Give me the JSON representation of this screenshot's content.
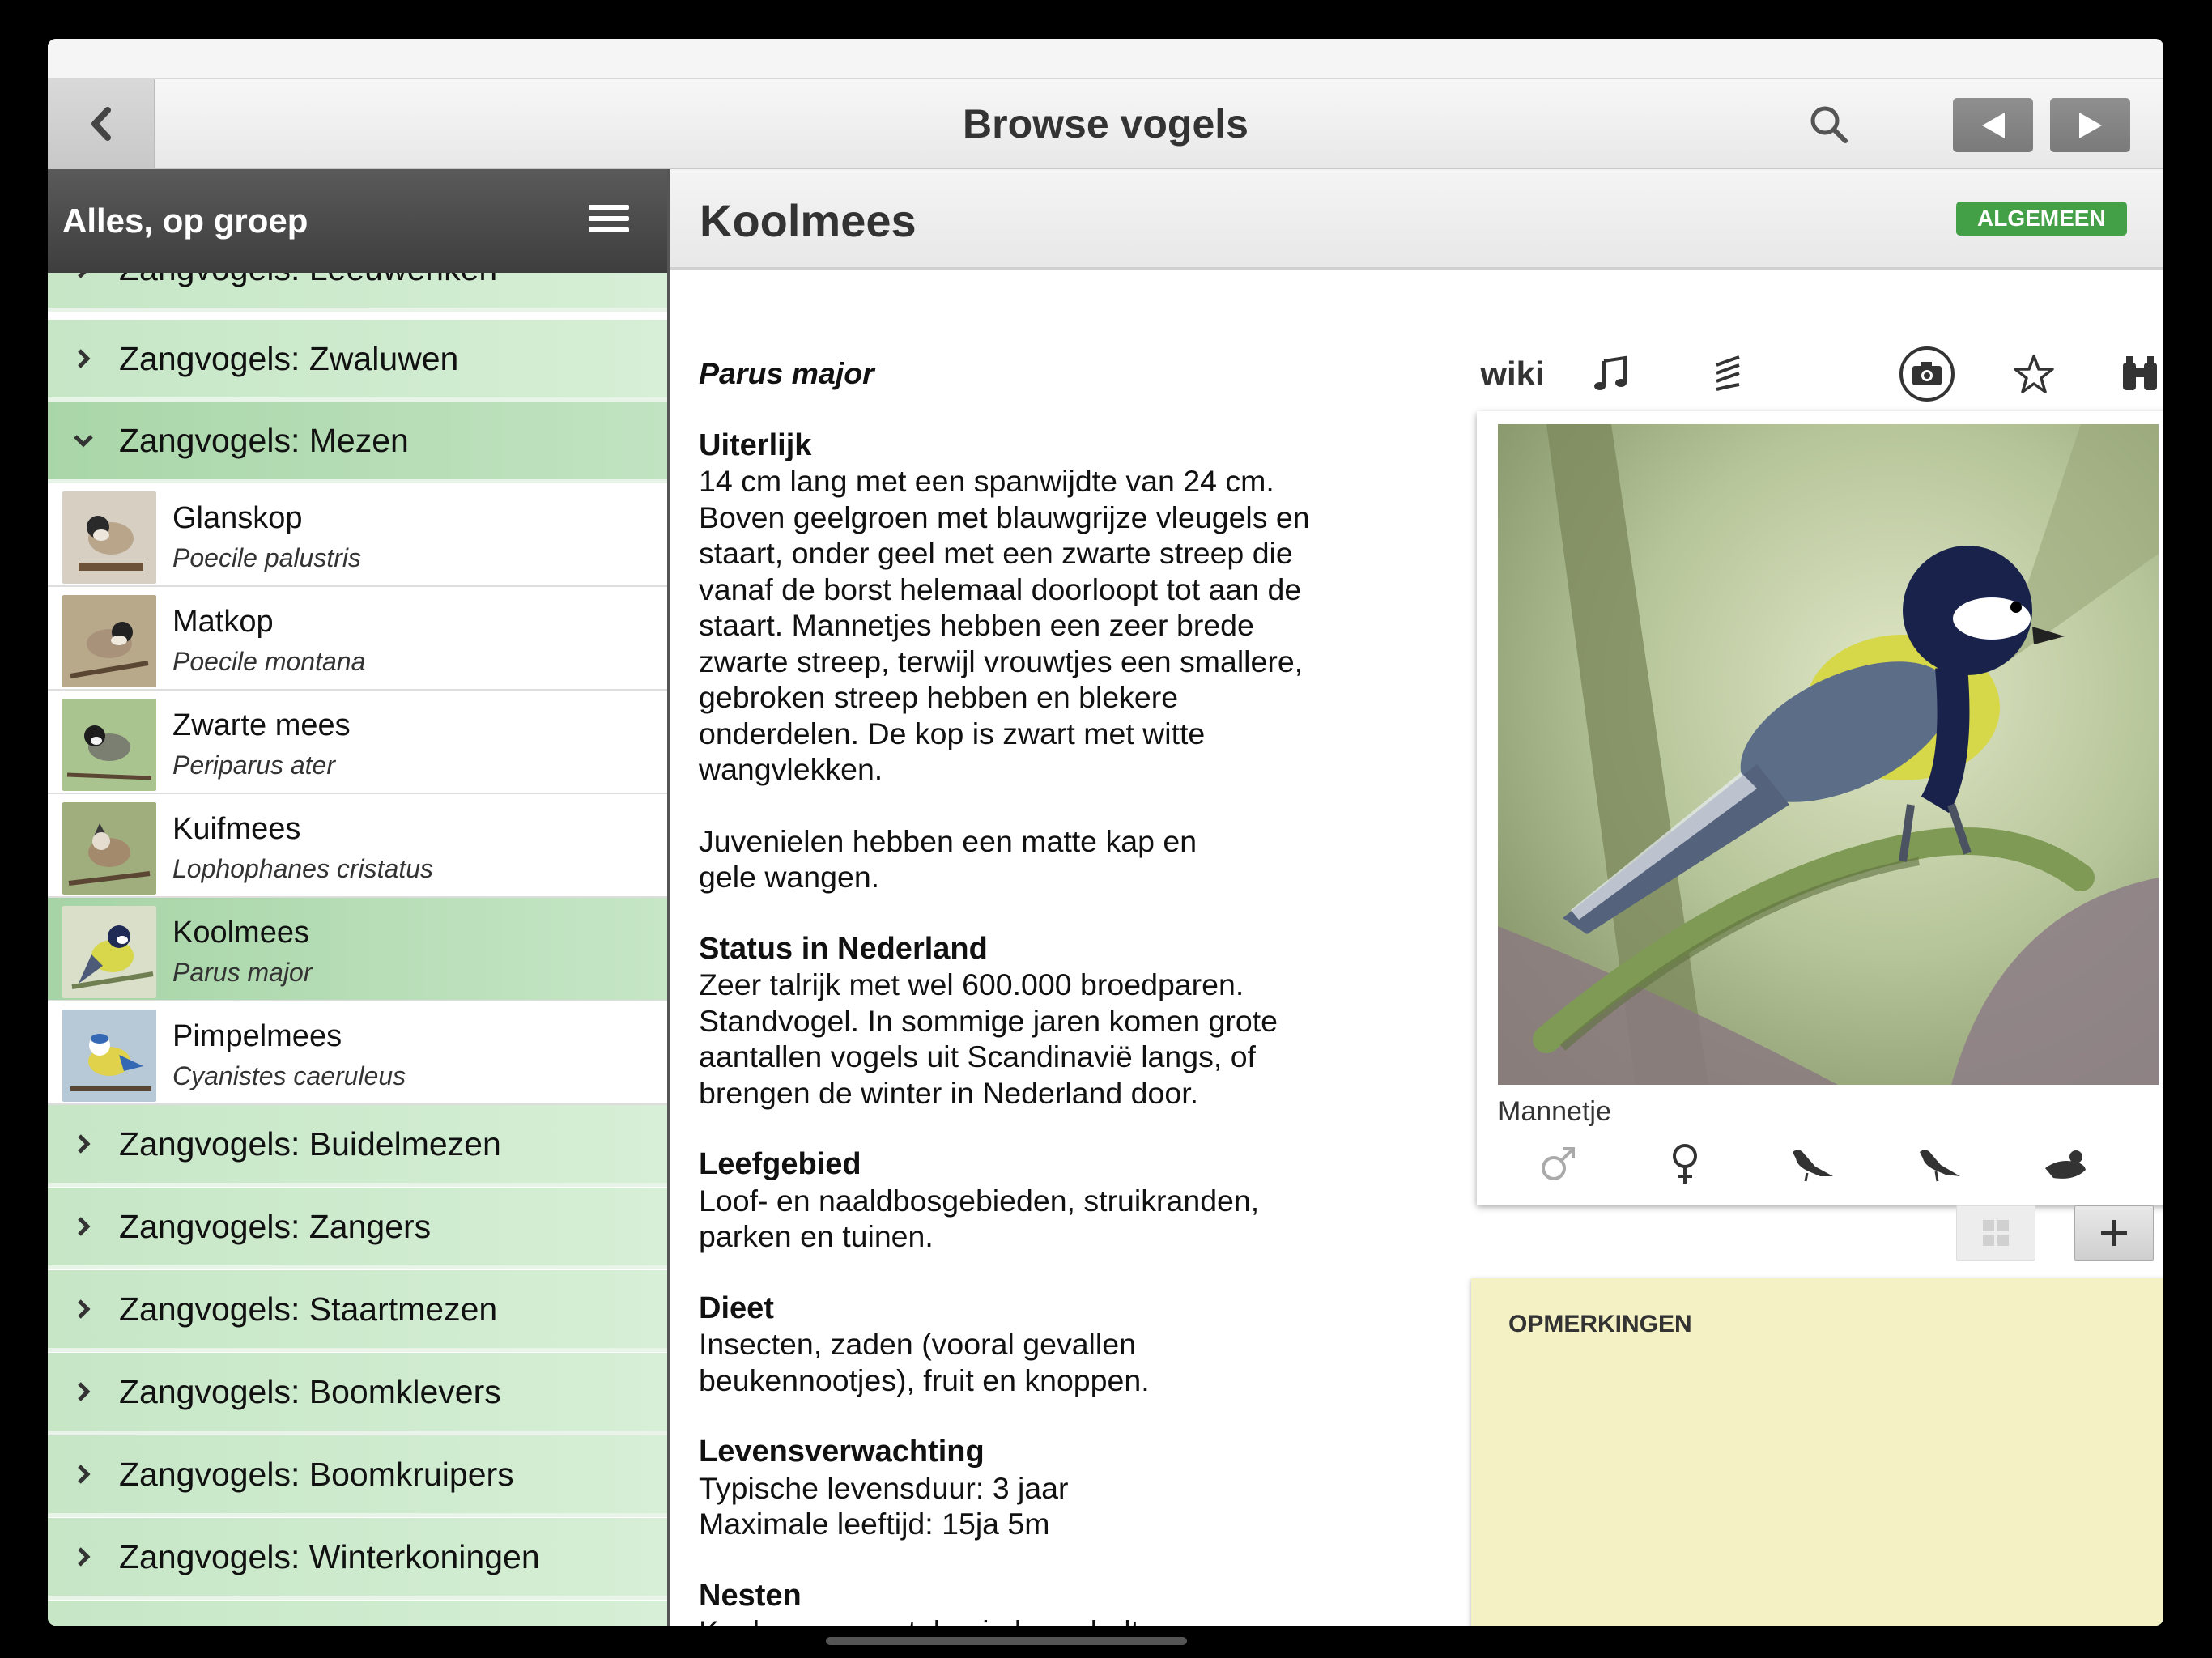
{
  "navbar": {
    "title": "Browse vogels",
    "back_icon": "chevron-left-icon",
    "search_icon": "search-icon",
    "prev_icon": "triangle-left-icon",
    "next_icon": "triangle-right-icon"
  },
  "sidebar": {
    "title": "Alles, op groep",
    "menu_icon": "hamburger-icon",
    "groups_before": [
      {
        "label": "Zangvogels: Leeuweriken"
      },
      {
        "label": "Zangvogels: Zwaluwen"
      }
    ],
    "expanded_group": {
      "label": "Zangvogels: Mezen"
    },
    "birds": [
      {
        "name": "Glanskop",
        "latin": "Poecile palustris"
      },
      {
        "name": "Matkop",
        "latin": "Poecile montana"
      },
      {
        "name": "Zwarte mees",
        "latin": "Periparus ater"
      },
      {
        "name": "Kuifmees",
        "latin": "Lophophanes cristatus"
      },
      {
        "name": "Koolmees",
        "latin": "Parus major",
        "selected": true
      },
      {
        "name": "Pimpelmees",
        "latin": "Cyanistes caeruleus"
      }
    ],
    "groups_after": [
      {
        "label": "Zangvogels: Buidelmezen"
      },
      {
        "label": "Zangvogels: Zangers"
      },
      {
        "label": "Zangvogels: Staartmezen"
      },
      {
        "label": "Zangvogels: Boomklevers"
      },
      {
        "label": "Zangvogels: Boomkruipers"
      },
      {
        "label": "Zangvogels: Winterkoningen"
      }
    ]
  },
  "detail": {
    "title": "Koolmees",
    "status_badge": "ALGEMEEN",
    "latin": "Parus major",
    "sections": [
      {
        "heading": "Uiterlijk",
        "text": "14 cm lang met een spanwijdte van 24 cm.\nBoven geelgroen met blauwgrijze vleugels en\nstaart, onder geel met een zwarte streep die\nvanaf de borst helemaal doorloopt tot aan de\nstaart. Mannetjes hebben een zeer brede\nzwarte streep, terwijl vrouwtjes een smallere,\ngebroken streep hebben en blekere\nonderdelen. De kop is zwart met witte\nwangvlekken."
      },
      {
        "heading": "",
        "text": "Juvenielen hebben een matte kap en\ngele wangen."
      },
      {
        "heading": "Status in Nederland",
        "text": "Zeer talrijk met wel 600.000 broedparen.\nStandvogel. In sommige jaren komen grote\naantallen vogels uit Scandinavië langs, of\nbrengen de winter in Nederland door."
      },
      {
        "heading": "Leefgebied",
        "text": "Loof- en naaldbosgebieden, struikranden,\nparken en tuinen."
      },
      {
        "heading": "Dieet",
        "text": "Insecten, zaden (vooral gevallen\nbeukennootjes), fruit en knoppen."
      },
      {
        "heading": "Levensverwachting",
        "text": "Typische levensduur: 3 jaar\nMaximale leeftijd: 15ja 5m"
      },
      {
        "heading": "Nesten",
        "text": "Koolmezen nestelen in boomholtes en muren,"
      }
    ],
    "tabs": {
      "wiki": "wiki",
      "icons": [
        "music-note-icon",
        "sonogram-icon",
        "camera-icon",
        "star-icon",
        "binoculars-icon"
      ]
    },
    "photo": {
      "caption": "Mannetje",
      "alt": "Koolmees foto"
    },
    "photo_filters": [
      "male-symbol-icon",
      "female-symbol-icon",
      "bird-perched-icon",
      "bird-flying-icon",
      "bird-swimming-icon",
      "more-vertical-icon"
    ],
    "add_label": "+",
    "notes_title": "OPMERKINGEN"
  },
  "colors": {
    "group_green": "#c6e6c6",
    "selected_green": "#a6d4a6",
    "badge_green": "#43a047",
    "notes_yellow": "#f4f2c4"
  }
}
